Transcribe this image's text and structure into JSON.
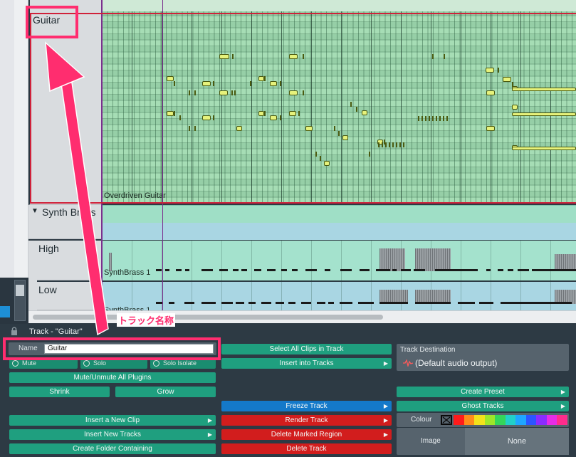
{
  "tracks": {
    "guitar": {
      "name": "Guitar",
      "clip": "Overdriven Guitar"
    },
    "synth_brass": {
      "name": "Synth Brass",
      "lanes": [
        {
          "name": "High",
          "clip": "SynthBrass 1"
        },
        {
          "name": "Low",
          "clip": "SynthBrass 1"
        }
      ]
    }
  },
  "annotation": {
    "label": "トラック名称"
  },
  "panel": {
    "title": "Track - \"Guitar\"",
    "name_label": "Name",
    "name_value": "Guitar",
    "mute": "Mute",
    "solo": "Solo",
    "solo_isolate": "Solo Isolate",
    "mute_plugins": "Mute/Unmute All Plugins",
    "shrink": "Shrink",
    "grow": "Grow",
    "insert_clip": "Insert a New Clip",
    "insert_tracks": "Insert New Tracks",
    "create_folder": "Create Folder Containing",
    "select_clips": "Select All Clips in Track",
    "insert_into": "Insert into Tracks",
    "freeze": "Freeze Track",
    "render": "Render Track",
    "delete_region": "Delete Marked Region",
    "delete_track": "Delete Track",
    "dest_title": "Track Destination",
    "dest_value": "(Default audio output)",
    "create_preset": "Create Preset",
    "ghost_tracks": "Ghost Tracks",
    "colour_label": "Colour",
    "image_label": "Image",
    "image_value": "None"
  },
  "colours": [
    "#ff1b1b",
    "#ff8c1a",
    "#f2e21b",
    "#9de62a",
    "#34d65a",
    "#22d0c8",
    "#1fa6ff",
    "#2c55ff",
    "#8a2cff",
    "#e62ce6",
    "#ff2c8c"
  ],
  "icons": {
    "lock": "lock-icon",
    "wave": "audio-wave-icon",
    "arrow": "chevron-right-icon"
  }
}
